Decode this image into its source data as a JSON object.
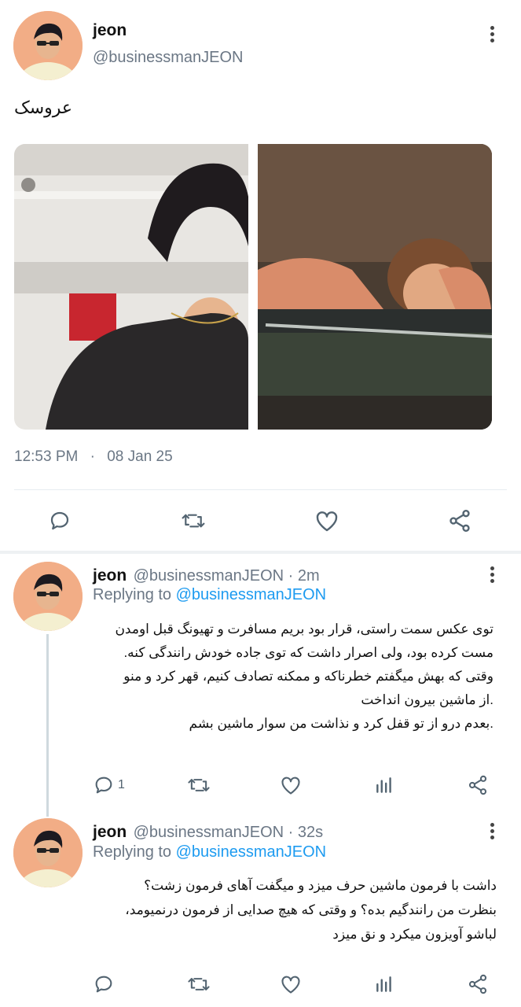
{
  "main_tweet": {
    "author_name": "jeon",
    "author_handle": "@businessmanJEON",
    "text": "عروسک",
    "timestamp_time": "12:53 PM",
    "timestamp_sep": "·",
    "timestamp_date": "08 Jan 25"
  },
  "replies": [
    {
      "author_name": "jeon",
      "meta": "@businessmanJEON · 2m",
      "replying_prefix": "Replying to ",
      "replying_handle": "@businessmanJEON",
      "lines": [
        "توی عکس سمت راستی، قرار بود بریم مسافرت و تهیونگ قبل اومدن",
        "مست کرده بود، ولی اصرار داشت که توی جاده خودش رانندگی کنه.",
        "وقتی که بهش میگفتم خطرناکه و ممکنه تصادف کنیم، قهر کرد و منو",
        ".از ماشین بیرون انداخت",
        ".بعدم درو از تو قفل کرد و نذاشت من سوار ماشین بشم"
      ],
      "reply_count": "1"
    },
    {
      "author_name": "jeon",
      "meta": "@businessmanJEON · 32s",
      "replying_prefix": "Replying to ",
      "replying_handle": "@businessmanJEON",
      "lines": [
        "داشت با فرمون ماشین حرف میزد و میگفت آهای فرمون زشت؟",
        "بنظرت من رانندگیم بده؟ و وقتی که هیچ صدایی از فرمون درنمیومد،",
        "لباشو آویزون میکرد و نق میزد"
      ],
      "reply_count": ""
    }
  ],
  "icons": {
    "reply": "reply-icon",
    "retweet": "retweet-icon",
    "like": "heart-icon",
    "share": "share-icon",
    "analytics": "analytics-icon",
    "more": "more-options-icon"
  },
  "colors": {
    "link": "#1d9bf0",
    "secondary_text": "#6b7785",
    "divider": "#e6ecf0",
    "icon": "#536471"
  }
}
